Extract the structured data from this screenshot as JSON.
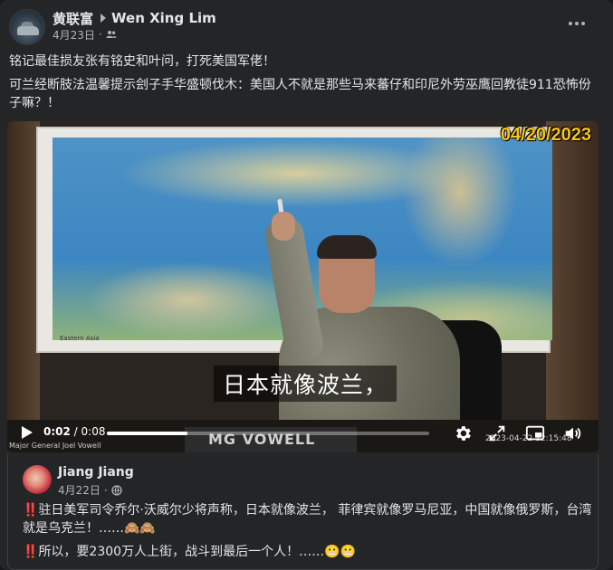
{
  "post": {
    "author": "黄联富",
    "target": "Wen Xing Lim",
    "date": "4月23日",
    "separator": "·",
    "line1": "铭记最佳损友张有铭史和叶问，打死美国军佬！",
    "line2": "可兰经断肢法温馨提示刽子手华盛顿伐木：美国人不就是那些马来蕃仔和印尼外劳巫鹰回教徒911恐怖份子嘛？！"
  },
  "video": {
    "date_stamp": "04/20/2023",
    "subtitle": "日本就像波兰，",
    "map_label": "Eastern Asia",
    "speaker_caption": "Major General Joel Vowell",
    "nameplate": "MG VOWELL",
    "watermark": "2023-04-22 12:15:48",
    "current_time": "0:02",
    "time_separator": " / ",
    "duration": "0:08",
    "progress_fraction": 0.25
  },
  "shared": {
    "author": "Jiang Jiang",
    "date": "4月22日",
    "separator": "·",
    "text1": "驻日美军司令乔尔·沃威尔少将声称，日本就像波兰， 菲律宾就像罗马尼亚，中国就像俄罗斯，台湾就是乌克兰！……🙈🙈",
    "text2": "所以，要2300万人上街，战斗到最后一个人！……😬😬",
    "bang": "‼️"
  },
  "icons": {
    "more": "more-horizontal-icon",
    "audience": "friends-icon",
    "globe": "globe-icon",
    "play": "play-icon",
    "settings": "gear-icon",
    "fullscreen": "expand-icon",
    "pip": "picture-in-picture-icon",
    "volume": "volume-icon"
  }
}
